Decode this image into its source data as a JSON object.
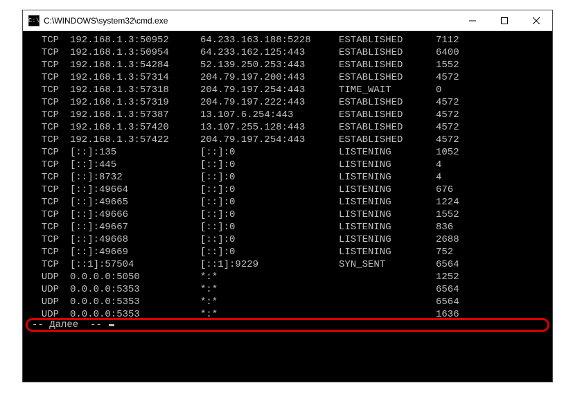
{
  "window": {
    "title": "C:\\WINDOWS\\system32\\cmd.exe"
  },
  "rows": [
    {
      "proto": "TCP",
      "local": "192.168.1.3:50952",
      "foreign": "64.233.163.188:5228",
      "state": "ESTABLISHED",
      "pid": "7112"
    },
    {
      "proto": "TCP",
      "local": "192.168.1.3:50954",
      "foreign": "64.233.162.125:443",
      "state": "ESTABLISHED",
      "pid": "6400"
    },
    {
      "proto": "TCP",
      "local": "192.168.1.3:54284",
      "foreign": "52.139.250.253:443",
      "state": "ESTABLISHED",
      "pid": "1552"
    },
    {
      "proto": "TCP",
      "local": "192.168.1.3:57314",
      "foreign": "204.79.197.200:443",
      "state": "ESTABLISHED",
      "pid": "4572"
    },
    {
      "proto": "TCP",
      "local": "192.168.1.3:57318",
      "foreign": "204.79.197.254:443",
      "state": "TIME_WAIT",
      "pid": "0"
    },
    {
      "proto": "TCP",
      "local": "192.168.1.3:57319",
      "foreign": "204.79.197.222:443",
      "state": "ESTABLISHED",
      "pid": "4572"
    },
    {
      "proto": "TCP",
      "local": "192.168.1.3:57387",
      "foreign": "13.107.6.254:443",
      "state": "ESTABLISHED",
      "pid": "4572"
    },
    {
      "proto": "TCP",
      "local": "192.168.1.3:57420",
      "foreign": "13.107.255.128:443",
      "state": "ESTABLISHED",
      "pid": "4572"
    },
    {
      "proto": "TCP",
      "local": "192.168.1.3:57422",
      "foreign": "204.79.197.254:443",
      "state": "ESTABLISHED",
      "pid": "4572"
    },
    {
      "proto": "TCP",
      "local": "[::]:135",
      "foreign": "[::]:0",
      "state": "LISTENING",
      "pid": "1052"
    },
    {
      "proto": "TCP",
      "local": "[::]:445",
      "foreign": "[::]:0",
      "state": "LISTENING",
      "pid": "4"
    },
    {
      "proto": "TCP",
      "local": "[::]:8732",
      "foreign": "[::]:0",
      "state": "LISTENING",
      "pid": "4"
    },
    {
      "proto": "TCP",
      "local": "[::]:49664",
      "foreign": "[::]:0",
      "state": "LISTENING",
      "pid": "676"
    },
    {
      "proto": "TCP",
      "local": "[::]:49665",
      "foreign": "[::]:0",
      "state": "LISTENING",
      "pid": "1224"
    },
    {
      "proto": "TCP",
      "local": "[::]:49666",
      "foreign": "[::]:0",
      "state": "LISTENING",
      "pid": "1552"
    },
    {
      "proto": "TCP",
      "local": "[::]:49667",
      "foreign": "[::]:0",
      "state": "LISTENING",
      "pid": "836"
    },
    {
      "proto": "TCP",
      "local": "[::]:49668",
      "foreign": "[::]:0",
      "state": "LISTENING",
      "pid": "2688"
    },
    {
      "proto": "TCP",
      "local": "[::]:49669",
      "foreign": "[::]:0",
      "state": "LISTENING",
      "pid": "752"
    },
    {
      "proto": "TCP",
      "local": "[::1]:57504",
      "foreign": "[::1]:9229",
      "state": "SYN_SENT",
      "pid": "6564"
    },
    {
      "proto": "UDP",
      "local": "0.0.0.0:5050",
      "foreign": "*:*",
      "state": "",
      "pid": "1252"
    },
    {
      "proto": "UDP",
      "local": "0.0.0.0:5353",
      "foreign": "*:*",
      "state": "",
      "pid": "6564"
    },
    {
      "proto": "UDP",
      "local": "0.0.0.0:5353",
      "foreign": "*:*",
      "state": "",
      "pid": "6564"
    },
    {
      "proto": "UDP",
      "local": "0.0.0.0:5353",
      "foreign": "*:*",
      "state": "",
      "pid": "1636"
    }
  ],
  "pager": {
    "text": "-- Далее  -- "
  }
}
